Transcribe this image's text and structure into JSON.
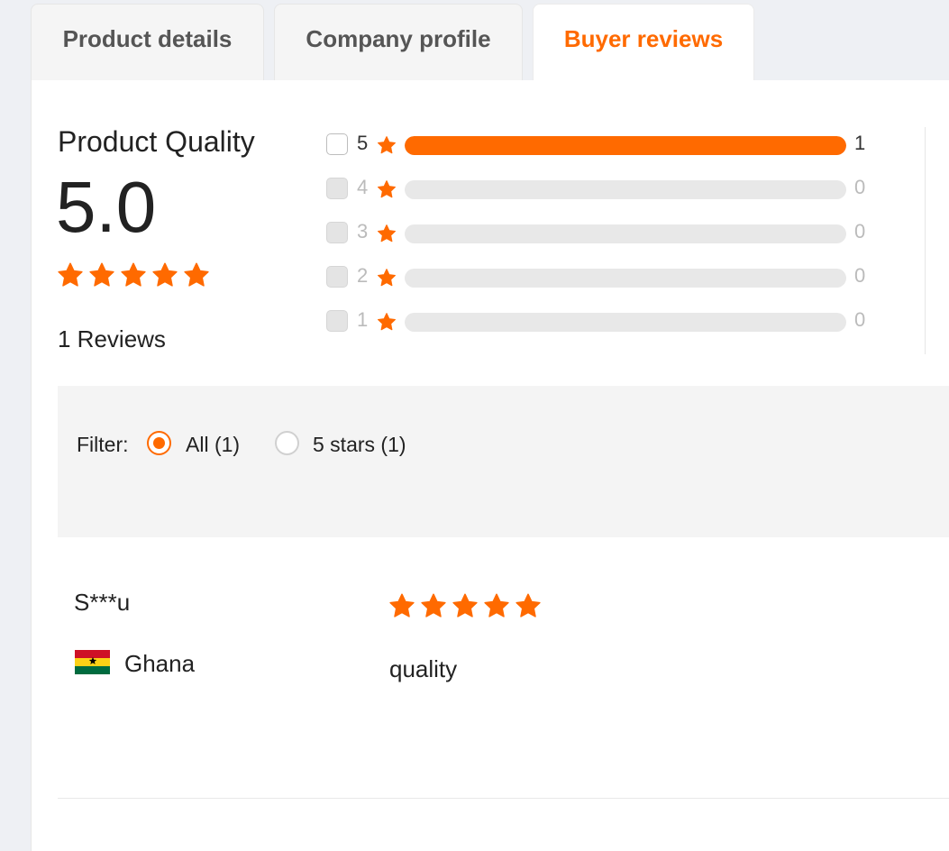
{
  "tabs": [
    {
      "label": "Product details",
      "active": false
    },
    {
      "label": "Company profile",
      "active": false
    },
    {
      "label": "Buyer reviews",
      "active": true
    }
  ],
  "summary": {
    "title": "Product Quality",
    "score": "5.0",
    "rating": 5,
    "reviews_label": "1 Reviews"
  },
  "distribution": [
    {
      "stars": "5",
      "count": "1",
      "fraction": 1.0
    },
    {
      "stars": "4",
      "count": "0",
      "fraction": 0
    },
    {
      "stars": "3",
      "count": "0",
      "fraction": 0
    },
    {
      "stars": "2",
      "count": "0",
      "fraction": 0
    },
    {
      "stars": "1",
      "count": "0",
      "fraction": 0
    }
  ],
  "filter": {
    "label": "Filter:",
    "options": [
      {
        "label": "All (1)",
        "checked": true
      },
      {
        "label": "5 stars (1)",
        "checked": false
      }
    ]
  },
  "reviews": [
    {
      "reviewer": "S***u",
      "country": "Ghana",
      "flag_icon": "ghana-flag-icon",
      "rating": 5,
      "text": "quality"
    }
  ],
  "colors": {
    "accent": "#ff6a00",
    "bar_empty": "#e8e8e8",
    "filter_bg": "#f4f4f4"
  },
  "icons": {
    "star": "star-icon",
    "radio": "radio-button"
  }
}
